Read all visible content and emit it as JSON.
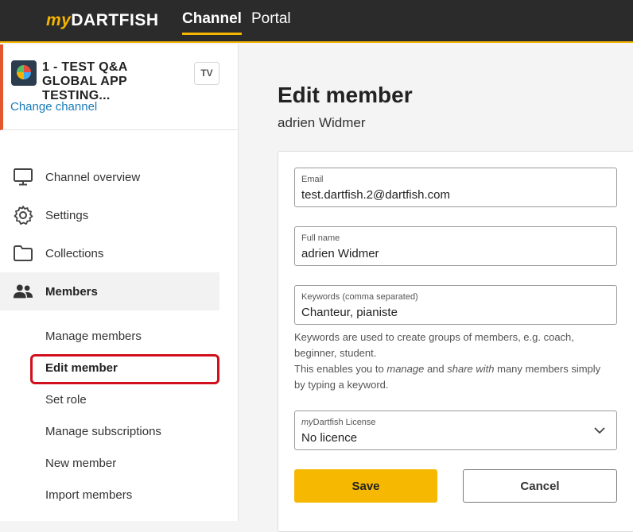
{
  "topbar": {
    "logo_prefix": "my",
    "logo_main": "DARTFISH",
    "tabs": [
      {
        "label": "Channel",
        "active": true
      },
      {
        "label": "Portal",
        "active": false
      }
    ]
  },
  "channel": {
    "name": "1 - TEST Q&A GLOBAL APP TESTING...",
    "tv_label": "TV",
    "change_link": "Change channel"
  },
  "nav": {
    "items": [
      {
        "label": "Channel overview",
        "icon": "monitor-icon"
      },
      {
        "label": "Settings",
        "icon": "gear-icon"
      },
      {
        "label": "Collections",
        "icon": "folder-icon"
      },
      {
        "label": "Members",
        "icon": "users-icon",
        "active": true
      }
    ],
    "sub_items": [
      {
        "label": "Manage members"
      },
      {
        "label": "Edit member",
        "current": true
      },
      {
        "label": "Set role"
      },
      {
        "label": "Manage subscriptions"
      },
      {
        "label": "New member"
      },
      {
        "label": "Import members"
      }
    ]
  },
  "main": {
    "title": "Edit member",
    "subtitle": "adrien Widmer",
    "form": {
      "email_label": "Email",
      "email_value": "test.dartfish.2@dartfish.com",
      "fullname_label": "Full name",
      "fullname_value": "adrien Widmer",
      "keywords_label": "Keywords (comma separated)",
      "keywords_value": "Chanteur, pianiste",
      "help_line1": "Keywords are used to create groups of members, e.g. coach, beginner, student.",
      "help_line2_a": "This enables you to ",
      "help_line2_b": "manage",
      "help_line2_c": " and ",
      "help_line2_d": "share with",
      "help_line2_e": " many members simply by typing a keyword.",
      "license_label_italic": "my",
      "license_label_rest": "Dartfish License",
      "license_value": "No licence"
    },
    "buttons": {
      "save": "Save",
      "cancel": "Cancel"
    }
  },
  "colors": {
    "accent": "#f6b400",
    "topbar_bg": "#2b2b2b",
    "link": "#1a7bb8",
    "highlight": "#d0101c"
  }
}
